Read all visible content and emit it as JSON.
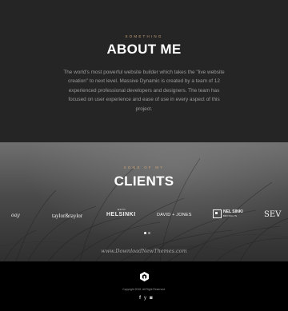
{
  "about": {
    "eyebrow": "SOMETHING",
    "title": "ABOUT ME",
    "body": "The world's most powerful website builder which takes the \"live website creation\" to next level. Massive Dynamic is created by a team of 12 experienced professional developers and designers. The team has focused on user experience and ease of use in every aspect of this project."
  },
  "clients": {
    "eyebrow": "SOME OF MY",
    "title": "CLIENTS",
    "logos": [
      {
        "text": "oay",
        "icon": "client-logo-script"
      },
      {
        "text": "taylor&taylor",
        "icon": "client-logo-taylor"
      },
      {
        "text": "HELSINKI",
        "subtext": "ESTD",
        "icon": "client-logo-helsinki"
      },
      {
        "text": "DAVID + JONES",
        "icon": "client-logo-david-jones"
      },
      {
        "text": "NEL SINKI",
        "subtext": "BROOKLYN",
        "icon": "client-logo-nelsinki"
      },
      {
        "text": "SEV",
        "icon": "client-logo-sev"
      }
    ],
    "carousel": {
      "pages": 2,
      "active": 1
    },
    "watermark": "www.DownloadNewThemes.com"
  },
  "footer": {
    "logo_icon": "hexagon-logo-icon",
    "copyright": "Copyright 2015. All Right Reserved.",
    "social": [
      {
        "name": "facebook-icon",
        "glyph": "f"
      },
      {
        "name": "twitter-icon",
        "glyph": "y"
      },
      {
        "name": "instagram-icon",
        "glyph": "◙"
      }
    ]
  },
  "colors": {
    "about_bg": "#252525",
    "accent": "#c8a37a",
    "footer_bg": "#000000"
  }
}
